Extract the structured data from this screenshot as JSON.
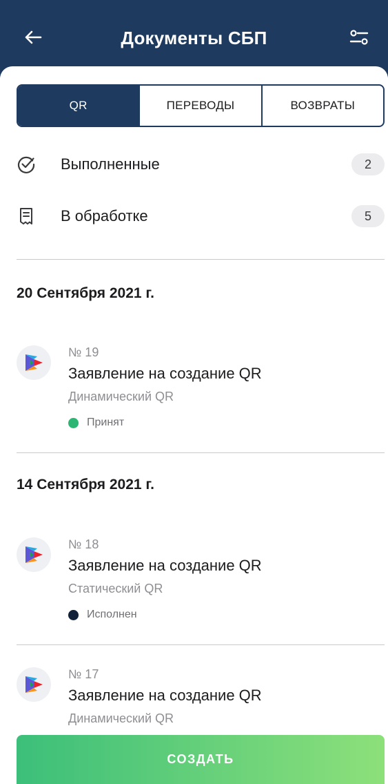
{
  "header": {
    "title": "Документы СБП",
    "back_icon": "arrow-left-icon",
    "filter_icon": "filter-sliders-icon",
    "bg_color": "#1e3a5f"
  },
  "tabs": [
    {
      "label": "QR",
      "active": true
    },
    {
      "label": "ПЕРЕВОДЫ",
      "active": false
    },
    {
      "label": "ВОЗВРАТЫ",
      "active": false
    }
  ],
  "summary": [
    {
      "icon": "check-circle-icon",
      "label": "Выполненные",
      "count": "2"
    },
    {
      "icon": "document-pending-icon",
      "label": "В обработке",
      "count": "5"
    }
  ],
  "groups": [
    {
      "date": "20 Сентября 2021 г.",
      "docs": [
        {
          "number": "№ 19",
          "name": "Заявление на создание QR",
          "type": "Динамический QR",
          "status": "Принят",
          "status_color": "#2bb673"
        }
      ]
    },
    {
      "date": "14 Сентября 2021 г.",
      "docs": [
        {
          "number": "№ 18",
          "name": "Заявление на создание QR",
          "type": "Статический QR",
          "status": "Исполнен",
          "status_color": "#12213a"
        },
        {
          "number": "№ 17",
          "name": "Заявление на создание QR",
          "type": "Динамический QR"
        }
      ]
    }
  ],
  "create_button": {
    "label": "СОЗДАТЬ",
    "gradient": [
      "#3cbf7a",
      "#8de07a"
    ]
  }
}
